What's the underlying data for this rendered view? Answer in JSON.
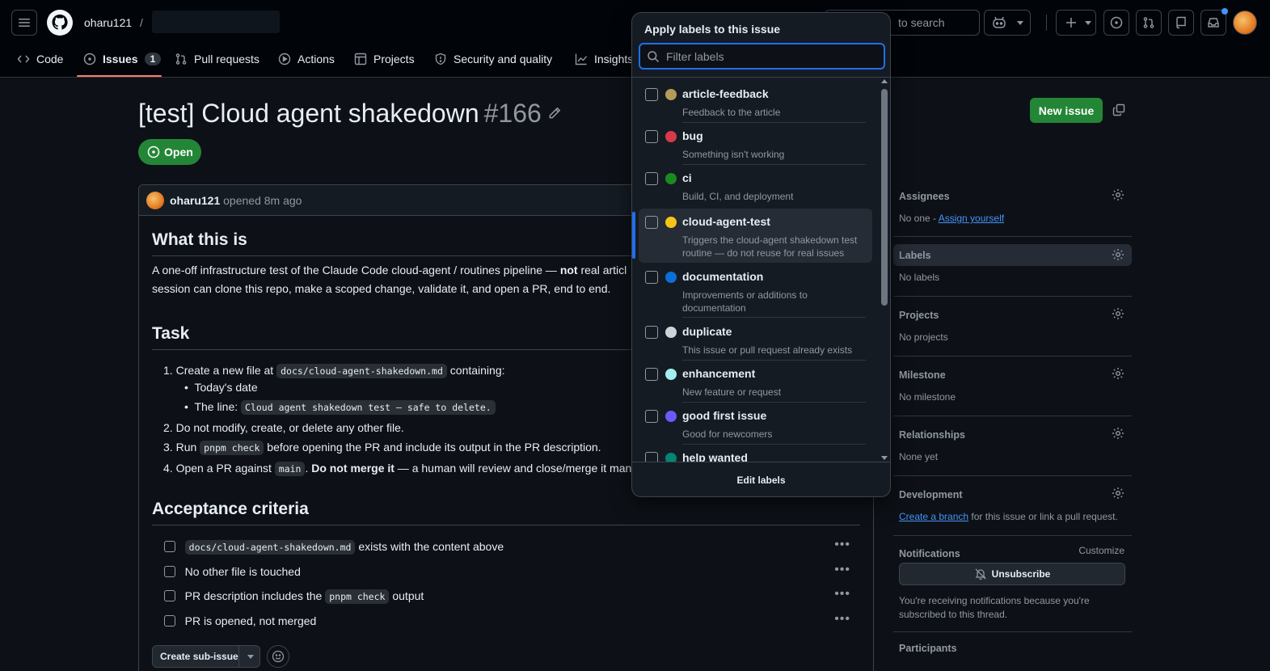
{
  "header": {
    "owner": "oharu121",
    "separator": "/",
    "search_placeholder": "to search"
  },
  "nav": [
    {
      "label": "Code",
      "icon": "code-icon"
    },
    {
      "label": "Issues",
      "icon": "issue-opened-icon",
      "count": "1"
    },
    {
      "label": "Pull requests",
      "icon": "git-pull-request-icon"
    },
    {
      "label": "Actions",
      "icon": "play-icon"
    },
    {
      "label": "Projects",
      "icon": "table-icon"
    },
    {
      "label": "Security and quality",
      "icon": "shield-icon"
    },
    {
      "label": "Insights",
      "icon": "graph-icon"
    }
  ],
  "issue": {
    "title": "[test] Cloud agent shakedown",
    "number": "#166",
    "state": "Open",
    "author": "oharu121",
    "opened": "opened 8m ago"
  },
  "body": {
    "h_what": "What this is",
    "p1_a": "A one-off infrastructure test of the Claude Code cloud-agent / routines pipeline — ",
    "p1_b": "not",
    "p1_c": " real articl",
    "p2": "session can clone this repo, make a scoped change, validate it, and open a PR, end to end.",
    "h_task": "Task",
    "t1_a": "Create a new file at ",
    "t1_code": "docs/cloud-agent-shakedown.md",
    "t1_b": " containing:",
    "t1_sub1": "Today's date",
    "t1_sub2_a": "The line: ",
    "t1_sub2_code": "Cloud agent shakedown test — safe to delete.",
    "t2": "Do not modify, create, or delete any other file.",
    "t3_a": "Run ",
    "t3_code": "pnpm check",
    "t3_b": " before opening the PR and include its output in the PR description.",
    "t4_a": "Open a PR against ",
    "t4_code": "main",
    "t4_b": ". ",
    "t4_bold": "Do not merge it",
    "t4_c": " — a human will review and close/merge it manua",
    "h_accept": "Acceptance criteria",
    "c1_code": "docs/cloud-agent-shakedown.md",
    "c1_text": " exists with the content above",
    "c2": "No other file is touched",
    "c3_a": "PR description includes the ",
    "c3_code": "pnpm check",
    "c3_b": " output",
    "c4": "PR is opened, not merged",
    "sub_issue": "Create sub-issue"
  },
  "sidebar": {
    "new_issue": "New issue",
    "assignees": "Assignees",
    "assignees_val": "No one - ",
    "assign_yourself": "Assign yourself",
    "labels": "Labels",
    "labels_val": "No labels",
    "projects": "Projects",
    "projects_val": "No projects",
    "milestone": "Milestone",
    "milestone_val": "No milestone",
    "relationships": "Relationships",
    "relationships_val": "None yet",
    "development": "Development",
    "create_branch": "Create a branch",
    "dev_rest": " for this issue or link a pull request.",
    "notifications": "Notifications",
    "customize": "Customize",
    "unsubscribe": "Unsubscribe",
    "notif_text1": "You're receiving notifications because you're",
    "notif_text2": "subscribed to this thread.",
    "participants": "Participants"
  },
  "popup": {
    "title": "Apply labels to this issue",
    "filter_placeholder": "Filter labels",
    "edit": "Edit labels",
    "labels": [
      {
        "name": "article-feedback",
        "desc": "Feedback to the article",
        "color": "#b59b5a"
      },
      {
        "name": "bug",
        "desc": "Something isn't working",
        "color": "#d73a4a"
      },
      {
        "name": "ci",
        "desc": "Build, CI, and deployment",
        "color": "#1a8a22"
      },
      {
        "name": "cloud-agent-test",
        "desc": "Triggers the cloud-agent shakedown test routine — do not reuse for real issues",
        "color": "#f5c518"
      },
      {
        "name": "documentation",
        "desc": "Improvements or additions to documentation",
        "color": "#0b6fd8"
      },
      {
        "name": "duplicate",
        "desc": "This issue or pull request already exists",
        "color": "#cfd3d7"
      },
      {
        "name": "enhancement",
        "desc": "New feature or request",
        "color": "#a2eeef"
      },
      {
        "name": "good first issue",
        "desc": "Good for newcomers",
        "color": "#7057ff"
      },
      {
        "name": "help wanted",
        "desc": "",
        "color": "#008672"
      }
    ]
  },
  "colors": {
    "accent": "#1f6feb",
    "open_green": "#238636",
    "link": "#4493f8"
  }
}
